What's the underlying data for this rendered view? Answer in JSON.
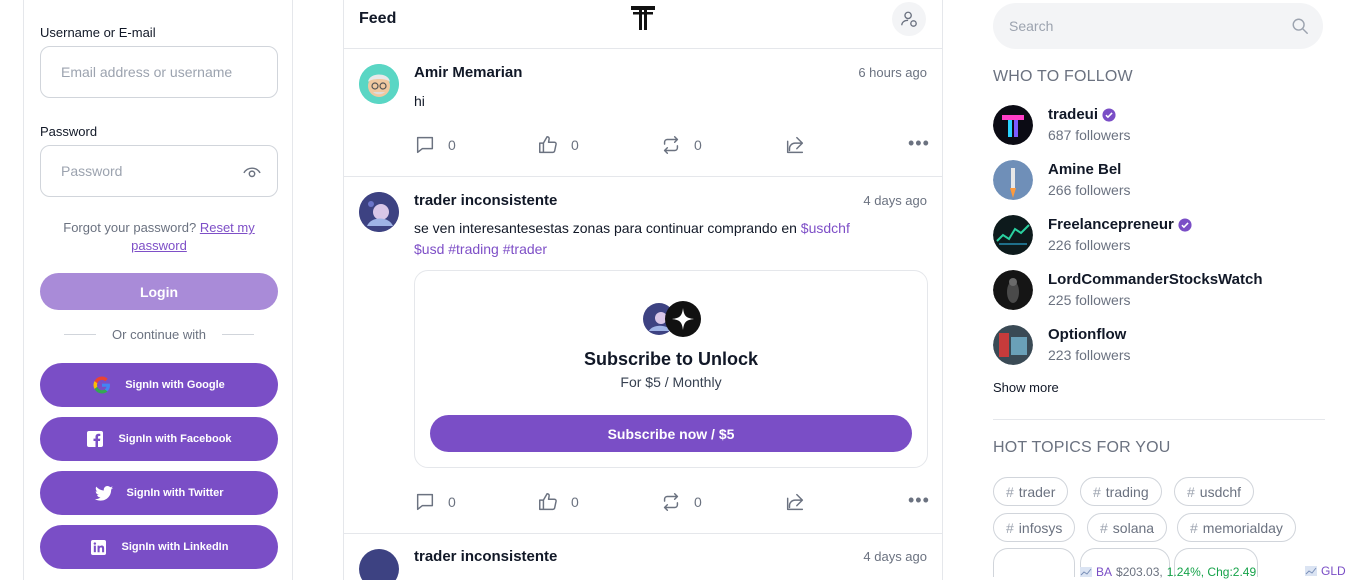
{
  "login": {
    "username_label": "Username or E-mail",
    "username_placeholder": "Email address or username",
    "password_label": "Password",
    "password_placeholder": "Password",
    "forgot_text": "Forgot your password?",
    "reset_link": "Reset my password",
    "login_button": "Login",
    "or_continue": "Or continue with",
    "social": [
      {
        "label": "SignIn with Google",
        "icon": "google-icon"
      },
      {
        "label": "SignIn with Facebook",
        "icon": "facebook-icon"
      },
      {
        "label": "SignIn with Twitter",
        "icon": "twitter-icon"
      },
      {
        "label": "SignIn with LinkedIn",
        "icon": "linkedin-icon"
      }
    ]
  },
  "feed": {
    "title": "Feed",
    "posts": [
      {
        "author": "Amir Memarian",
        "time": "6 hours ago",
        "text": "hi",
        "comments": "0",
        "likes": "0",
        "reposts": "0"
      },
      {
        "author": "trader inconsistente",
        "time": "4 days ago",
        "text_plain": "se ven interesantesestas zonas para continuar comprando en",
        "tags": [
          "$usdchf",
          "$usd",
          "#trading",
          "#trader"
        ],
        "locked": {
          "title": "Subscribe to Unlock",
          "price": "For $5 / Monthly",
          "button": "Subscribe now / $5"
        },
        "comments": "0",
        "likes": "0",
        "reposts": "0"
      },
      {
        "author": "trader inconsistente",
        "time": "4 days ago"
      }
    ]
  },
  "sidebar": {
    "search_placeholder": "Search",
    "who_to_follow_title": "WHO TO FOLLOW",
    "follow": [
      {
        "name": "tradeui",
        "followers": "687 followers",
        "verified": true
      },
      {
        "name": "Amine Bel",
        "followers": "266 followers",
        "verified": false
      },
      {
        "name": "Freelancepreneur",
        "followers": "226 followers",
        "verified": true
      },
      {
        "name": "LordCommanderStocksWatch",
        "followers": "225 followers",
        "verified": false
      },
      {
        "name": "Optionflow",
        "followers": "223 followers",
        "verified": false
      }
    ],
    "show_more": "Show more",
    "hot_topics_title": "HOT TOPICS FOR YOU",
    "topics": [
      "trader",
      "trading",
      "usdchf",
      "infosys",
      "solana",
      "memorialday"
    ]
  },
  "ticker": {
    "symbol": "BA",
    "price": "$203.03,",
    "change": "1.24%, Chg:2.49",
    "symbol2": "GLD"
  },
  "colors": {
    "accent": "#7a4ec6",
    "accent_light": "#a98bd8",
    "tag": "#7e4fc7"
  }
}
